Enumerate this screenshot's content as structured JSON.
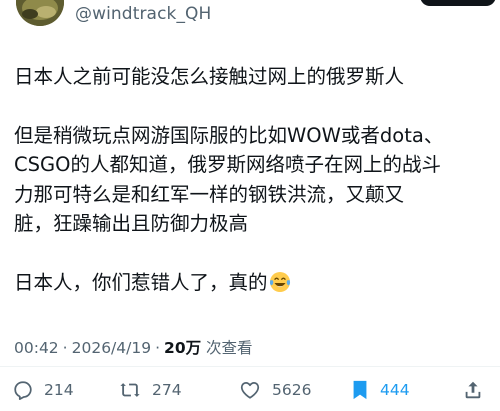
{
  "author": {
    "handle": "@windtrack_QH"
  },
  "tweet": {
    "lines": [
      "日本人之前可能没怎么接触过网上的俄罗斯人",
      "但是稍微玩点网游国际服的比如WOW或者dota、\nCSGO的人都知道，俄罗斯网络喷子在网上的战斗\n力那可特么是和红军一样的钢铁洪流，又颠又\n脏，狂躁输出且防御力极高",
      "日本人，你们惹错人了，真的"
    ],
    "emoji": "face-with-tears-of-joy"
  },
  "meta": {
    "time": "00:42",
    "separator": "·",
    "date": "2026/4/19",
    "views_count": "20万",
    "views_label": "次查看"
  },
  "actions": {
    "replies": "214",
    "retweets": "274",
    "likes": "5626",
    "bookmarks": "444"
  },
  "colors": {
    "text": "#0f1419",
    "secondary": "#536471",
    "accent": "#1d9bf0"
  }
}
